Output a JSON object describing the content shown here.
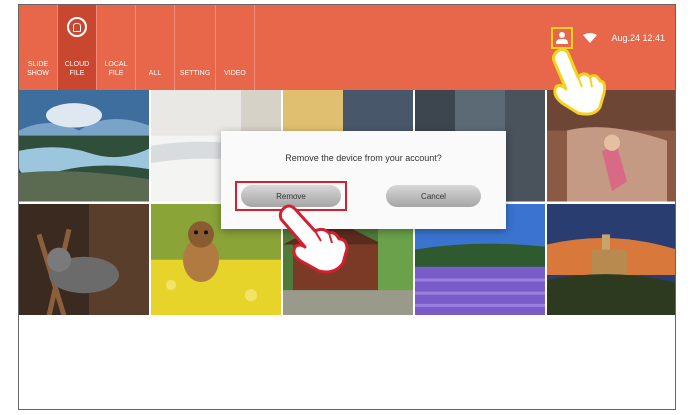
{
  "tabs": [
    {
      "line1": "SLIDE",
      "line2": "SHOW",
      "active": false
    },
    {
      "line1": "CLOUD",
      "line2": "FILE",
      "active": true
    },
    {
      "line1": "LOCAL",
      "line2": "FILE",
      "active": false
    },
    {
      "line1": "ALL",
      "line2": "",
      "active": false
    },
    {
      "line1": "SETTING",
      "line2": "",
      "active": false
    },
    {
      "line1": "VIDEO",
      "line2": "",
      "active": false
    }
  ],
  "status": {
    "datetime": "Aug.24  12:41"
  },
  "dialog": {
    "message": "Remove the device from your account?",
    "remove_label": "Remove",
    "cancel_label": "Cancel"
  },
  "photos": [
    {
      "name": "river-landscape"
    },
    {
      "name": "bed-interior"
    },
    {
      "name": "car-autumn"
    },
    {
      "name": "city-street"
    },
    {
      "name": "girl-on-couch"
    },
    {
      "name": "cat-chair"
    },
    {
      "name": "yorkie-dog-flowers"
    },
    {
      "name": "wooden-house"
    },
    {
      "name": "lavender-field"
    },
    {
      "name": "castle-sunset"
    }
  ],
  "colors": {
    "topbar": "#e8664a",
    "active_tab": "#c9472f",
    "highlight_yellow": "#f4d31f",
    "highlight_red": "#d32030"
  }
}
